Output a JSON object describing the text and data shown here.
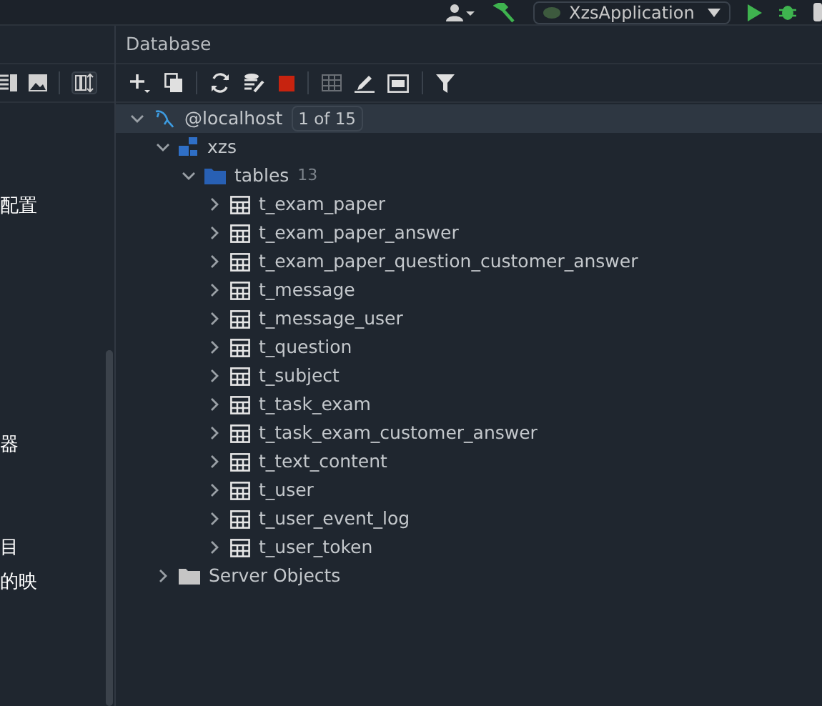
{
  "top_bar": {
    "run_config": "XzsApplication"
  },
  "left_panel": {
    "fragments": [
      "配置",
      "器",
      "目",
      "的映"
    ]
  },
  "database": {
    "title": "Database",
    "tree": [
      {
        "label": "@localhost",
        "badge": "1 of 15",
        "kind": "host",
        "expanded": true,
        "selected": true,
        "children": [
          {
            "label": "xzs",
            "kind": "schema",
            "expanded": true,
            "selected": false,
            "children": [
              {
                "label": "tables",
                "count": "13",
                "kind": "folder",
                "expanded": true,
                "selected": false,
                "children": [
                  {
                    "label": "t_exam_paper",
                    "kind": "table",
                    "expanded": false,
                    "selected": false
                  },
                  {
                    "label": "t_exam_paper_answer",
                    "kind": "table",
                    "expanded": false,
                    "selected": false
                  },
                  {
                    "label": "t_exam_paper_question_customer_answer",
                    "kind": "table",
                    "expanded": false,
                    "selected": false
                  },
                  {
                    "label": "t_message",
                    "kind": "table",
                    "expanded": false,
                    "selected": false
                  },
                  {
                    "label": "t_message_user",
                    "kind": "table",
                    "expanded": false,
                    "selected": false
                  },
                  {
                    "label": "t_question",
                    "kind": "table",
                    "expanded": false,
                    "selected": false
                  },
                  {
                    "label": "t_subject",
                    "kind": "table",
                    "expanded": false,
                    "selected": false
                  },
                  {
                    "label": "t_task_exam",
                    "kind": "table",
                    "expanded": false,
                    "selected": false
                  },
                  {
                    "label": "t_task_exam_customer_answer",
                    "kind": "table",
                    "expanded": false,
                    "selected": false
                  },
                  {
                    "label": "t_text_content",
                    "kind": "table",
                    "expanded": false,
                    "selected": false
                  },
                  {
                    "label": "t_user",
                    "kind": "table",
                    "expanded": false,
                    "selected": false
                  },
                  {
                    "label": "t_user_event_log",
                    "kind": "table",
                    "expanded": false,
                    "selected": false
                  },
                  {
                    "label": "t_user_token",
                    "kind": "table",
                    "expanded": false,
                    "selected": false
                  }
                ]
              }
            ]
          },
          {
            "label": "Server Objects",
            "kind": "server",
            "expanded": false,
            "selected": false
          }
        ]
      }
    ]
  }
}
